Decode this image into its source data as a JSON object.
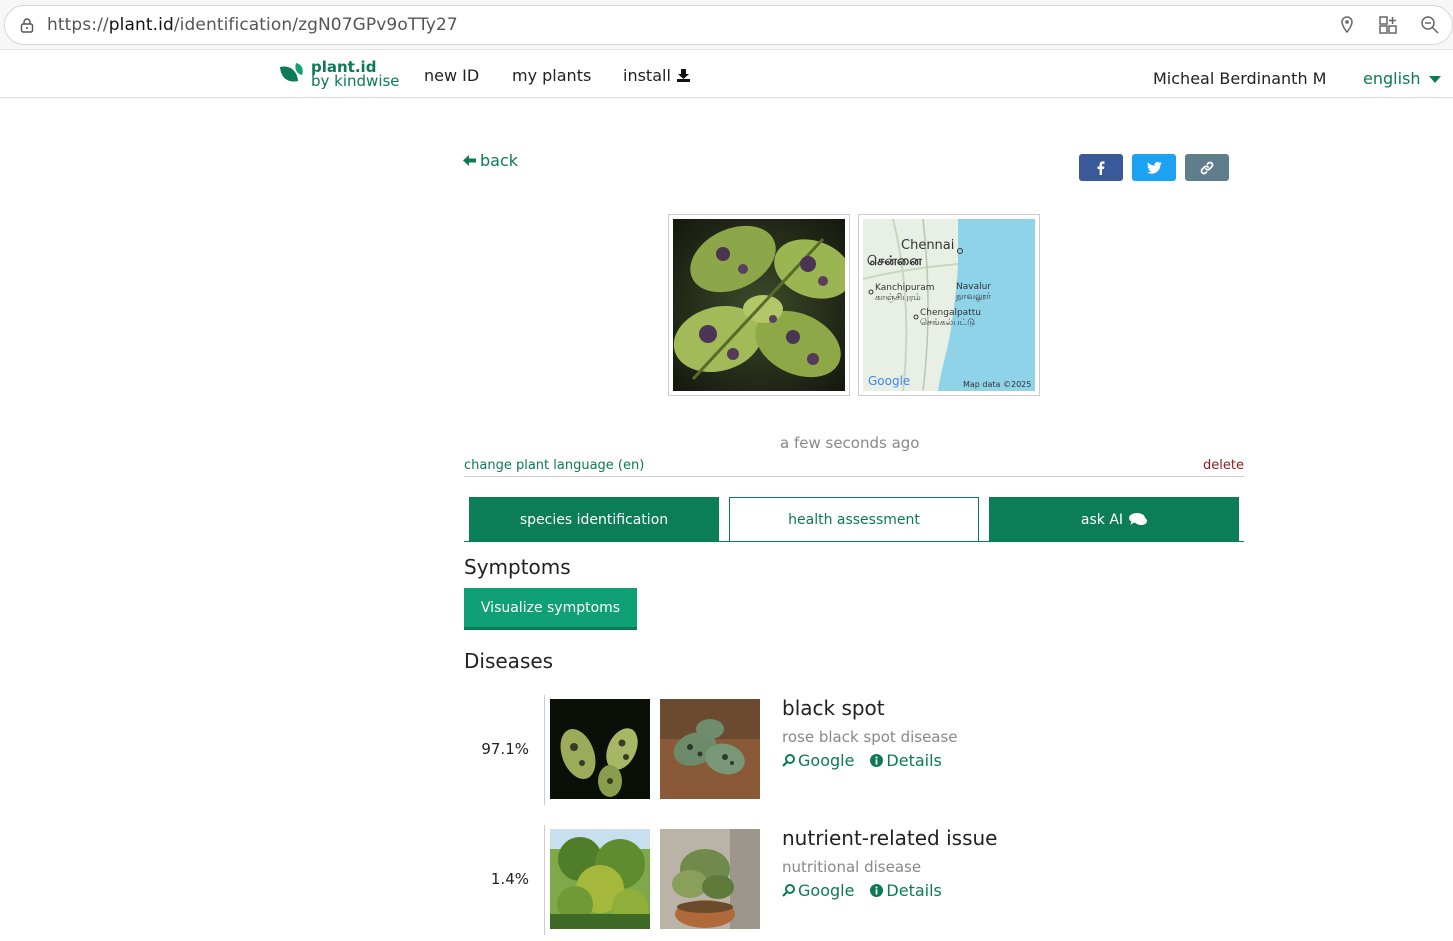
{
  "browser": {
    "url_prefix": "https://",
    "url_domain": "plant.id",
    "url_path": "/identification/zgN07GPv9oTTy27"
  },
  "header": {
    "logo_line1": "plant.id",
    "logo_line2": "by kindwise",
    "nav": [
      "new ID",
      "my plants",
      "install"
    ],
    "user": "Micheal Berdinanth M",
    "language": "english"
  },
  "page": {
    "back_label": "back",
    "timestamp": "a few seconds ago",
    "change_language": "change plant language (en)",
    "delete": "delete",
    "map_labels": {
      "city_en": "Chennai",
      "city_ta": "சென்னை",
      "town1_en": "Kanchipuram",
      "town1_ta": "காஞ்சிபுரம்",
      "town2_en": "Navalur",
      "town2_ta": "நாவலூர்",
      "town3_en": "Chengalpattu",
      "town3_ta": "செங்கல்பட்டு",
      "google": "Google",
      "map_data": "Map data ©2025"
    }
  },
  "tabs": {
    "species": "species identification",
    "health": "health assessment",
    "ask": "ask AI"
  },
  "sections": {
    "symptoms": "Symptoms",
    "visualize": "Visualize symptoms",
    "diseases": "Diseases"
  },
  "diseases": [
    {
      "pct": "97.1%",
      "name": "black spot",
      "sub": "rose black spot disease",
      "google": "Google",
      "details": "Details"
    },
    {
      "pct": "1.4%",
      "name": "nutrient-related issue",
      "sub": "nutritional disease",
      "google": "Google",
      "details": "Details"
    }
  ],
  "colors": {
    "brand_green": "#0b7d57",
    "facebook": "#3b5998",
    "twitter": "#1da1f2",
    "link": "#607d8b"
  }
}
